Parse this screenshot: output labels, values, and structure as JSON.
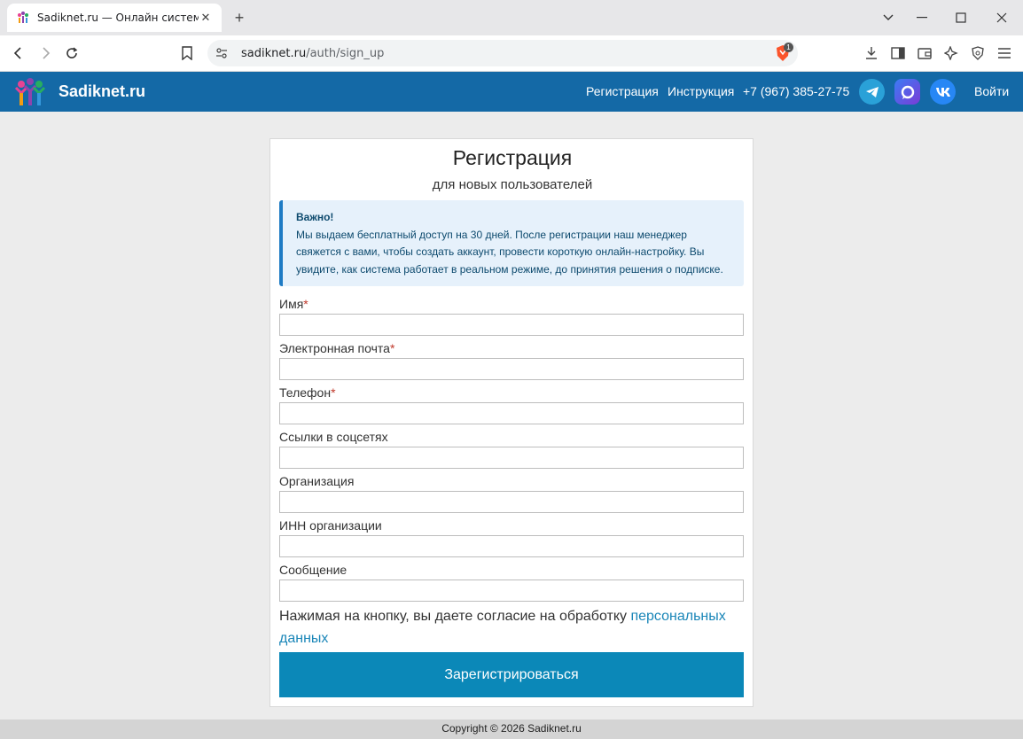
{
  "browser": {
    "tab_title": "Sadiknet.ru — Онлайн система у",
    "url_host": "sadiknet.ru",
    "url_path": "/auth/sign_up",
    "shield_count": "1"
  },
  "header": {
    "brand": "Sadiknet.ru",
    "nav": {
      "register": "Регистрация",
      "instructions": "Инструкция",
      "phone": "+7 (967) 385-27-75",
      "login": "Войти"
    },
    "colors": {
      "bar": "#1469a6",
      "telegram": "#2aa1d8",
      "max": "#5b3bd6",
      "vk": "#2787f5"
    }
  },
  "form": {
    "title": "Регистрация",
    "subtitle": "для новых пользователей",
    "notice_title": "Важно!",
    "notice_text": "Мы выдаем бесплатный доступ на 30 дней. После регистрации наш менеджер свяжется с вами, чтобы создать аккаунт, провести короткую онлайн-настройку. Вы увидите, как система работает в реальном режиме, до принятия решения о подписке.",
    "fields": {
      "name": {
        "label": "Имя",
        "required": "*",
        "value": ""
      },
      "email": {
        "label": "Электронная почта",
        "required": "*",
        "value": ""
      },
      "phone": {
        "label": "Телефон",
        "required": "*",
        "value": ""
      },
      "social": {
        "label": "Ссылки в соцсетях",
        "value": ""
      },
      "org": {
        "label": "Организация",
        "value": ""
      },
      "inn": {
        "label": "ИНН организации",
        "value": ""
      },
      "message": {
        "label": "Сообщение",
        "value": ""
      }
    },
    "consent_text": "Нажимая на кнопку, вы даете согласие на обработку ",
    "consent_link": "персональных данных",
    "submit": "Зарегистрироваться"
  },
  "footer": {
    "copyright": "Copyright © 2026 Sadiknet.ru"
  }
}
